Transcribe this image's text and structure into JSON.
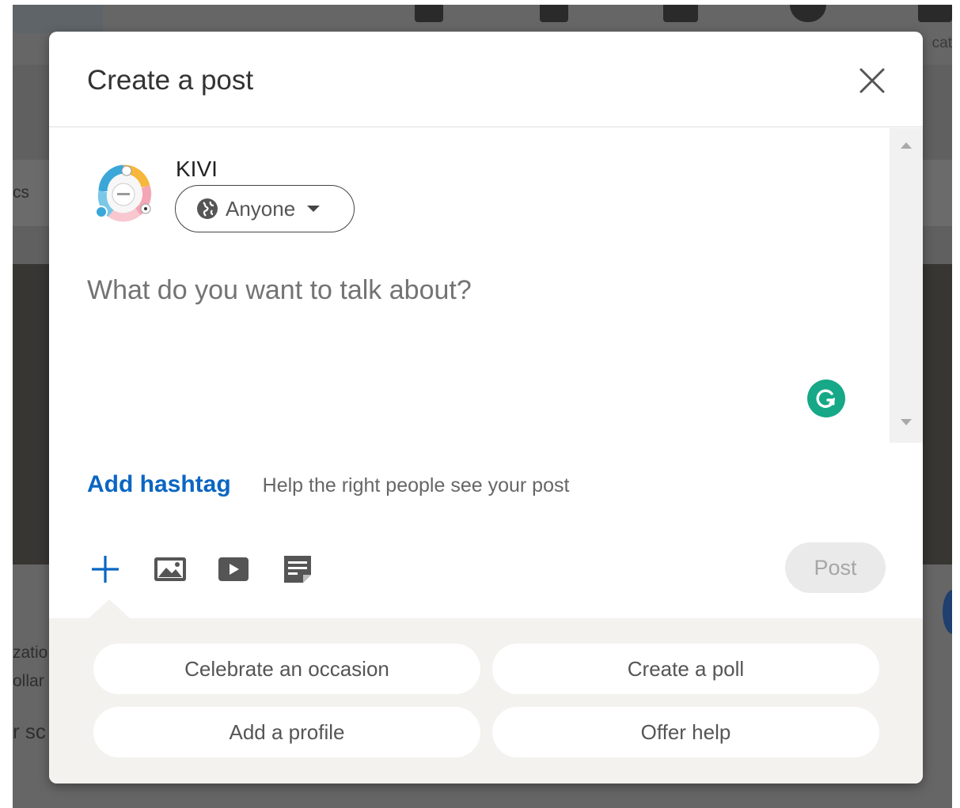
{
  "background": {
    "nav_label_fragment": "cat",
    "side_text_fragment": "cs",
    "lower_fragments": [
      "zatio",
      "ollar",
      "r sc"
    ]
  },
  "modal": {
    "title": "Create a post",
    "close_icon": "close-icon",
    "author": {
      "name": "KIVI",
      "audience": "Anyone",
      "audience_icon": "globe-icon"
    },
    "composer_placeholder": "What do you want to talk about?",
    "grammarly_color": "#16a887",
    "hashtag": {
      "link": "Add hashtag",
      "help": "Help the right people see your post"
    },
    "toolbar": {
      "icons": [
        "plus-icon",
        "photo-icon",
        "video-icon",
        "document-icon"
      ],
      "post_label": "Post"
    },
    "suggestions": [
      "Celebrate an occasion",
      "Create a poll",
      "Add a profile",
      "Offer help"
    ],
    "accent_color": "#0a66c2"
  }
}
